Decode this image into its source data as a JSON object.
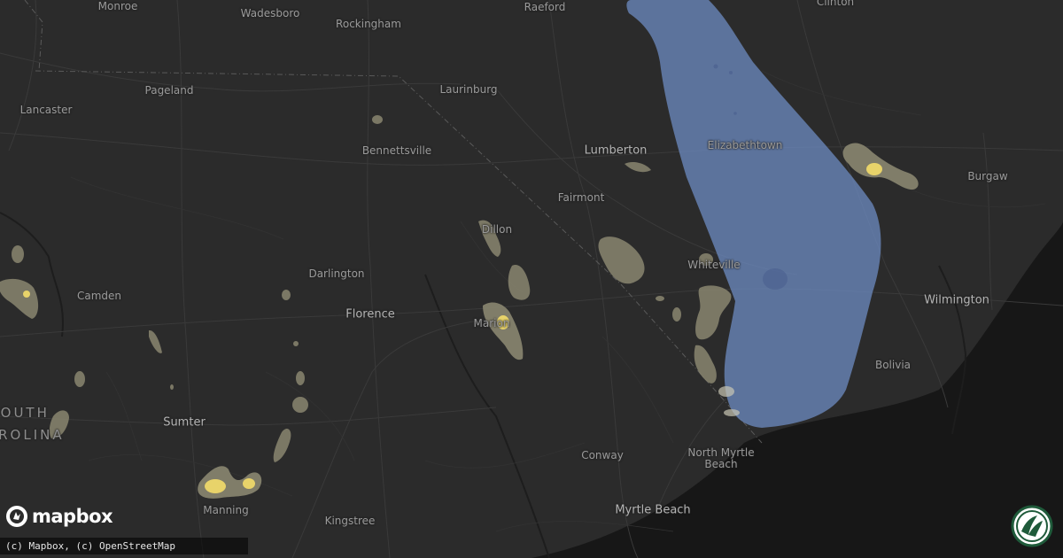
{
  "map": {
    "places": [
      {
        "id": "monroe",
        "name": "Monroe"
      },
      {
        "id": "wadesboro",
        "name": "Wadesboro"
      },
      {
        "id": "rockingham",
        "name": "Rockingham"
      },
      {
        "id": "raeford",
        "name": "Raeford"
      },
      {
        "id": "clinton",
        "name": "Clinton"
      },
      {
        "id": "pageland",
        "name": "Pageland"
      },
      {
        "id": "laurinburg",
        "name": "Laurinburg"
      },
      {
        "id": "lancaster",
        "name": "Lancaster"
      },
      {
        "id": "bennettsville",
        "name": "Bennettsville"
      },
      {
        "id": "lumberton",
        "name": "Lumberton"
      },
      {
        "id": "elizabethtown",
        "name": "Elizabethtown"
      },
      {
        "id": "burgaw",
        "name": "Burgaw"
      },
      {
        "id": "fairmont",
        "name": "Fairmont"
      },
      {
        "id": "dillon",
        "name": "Dillon"
      },
      {
        "id": "whiteville",
        "name": "Whiteville"
      },
      {
        "id": "darlington",
        "name": "Darlington"
      },
      {
        "id": "camden",
        "name": "Camden"
      },
      {
        "id": "wilmington",
        "name": "Wilmington"
      },
      {
        "id": "florence",
        "name": "Florence"
      },
      {
        "id": "marion",
        "name": "Marion"
      },
      {
        "id": "bolivia",
        "name": "Bolivia"
      },
      {
        "id": "sumter",
        "name": "Sumter"
      },
      {
        "id": "conway",
        "name": "Conway"
      },
      {
        "id": "north-myrtle-beach",
        "name": "North Myrtle\nBeach"
      },
      {
        "id": "manning",
        "name": "Manning"
      },
      {
        "id": "myrtle-beach",
        "name": "Myrtle Beach"
      },
      {
        "id": "kingstree",
        "name": "Kingstree"
      }
    ],
    "state_label": [
      "SOUTH",
      "CAROLINA"
    ],
    "colors": {
      "background": "#2b2b2b",
      "water": "#161616",
      "hail_zone_fill": "#6f8fc8",
      "storm_light": "#8a8670",
      "storm_core": "#e8d36a"
    }
  },
  "branding": {
    "logo_text": "mapbox",
    "attribution": "(c) Mapbox, (c) OpenStreetMap",
    "badge_icon": "ring-logo-icon"
  }
}
